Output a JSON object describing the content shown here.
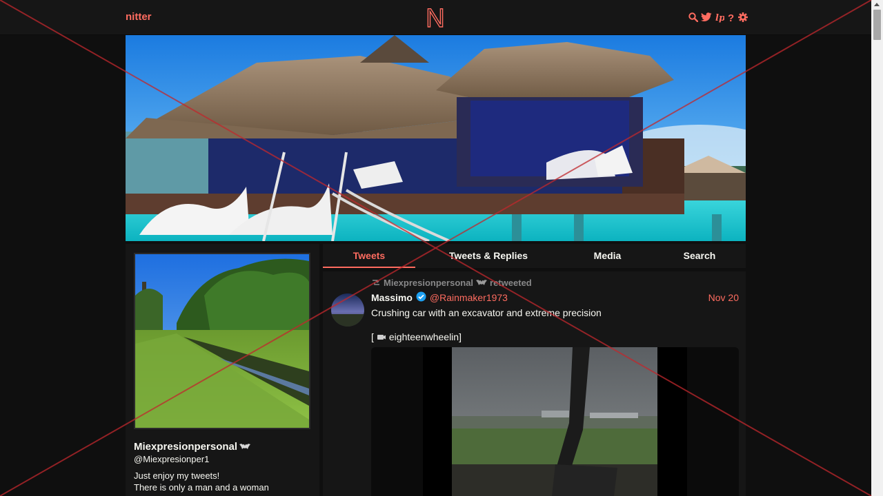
{
  "navbar": {
    "brand": "nitter",
    "logo_letter": "N",
    "icons": [
      "search-icon",
      "twitter-bird-icon",
      "rss-icon",
      "help-icon",
      "gear-icon"
    ]
  },
  "colors": {
    "accent": "#ff6c60",
    "background": "#0f0f0f",
    "panel": "#161616",
    "text": "#f8f8f2",
    "muted": "#888889",
    "verified": "#1da1f2",
    "overlay_x": "#c0282d"
  },
  "profile": {
    "fullname": "Miexpresionpersonal",
    "name_emoji_icon": "bat-icon",
    "username": "@Miexpresionper1",
    "bio": [
      "Just enjoy my tweets!",
      "There is only a man and a woman"
    ]
  },
  "tabs": [
    {
      "label": "Tweets",
      "active": true
    },
    {
      "label": "Tweets & Replies",
      "active": false
    },
    {
      "label": "Media",
      "active": false
    },
    {
      "label": "Search",
      "active": false
    }
  ],
  "tweet": {
    "retweet_by": "Miexpresionpersonal",
    "retweet_suffix": "retweeted",
    "fullname": "Massimo",
    "verified": true,
    "username": "@Rainmaker1973",
    "date": "Nov 20",
    "text": "Crushing car with an excavator and extreme precision",
    "credit_open": "[",
    "credit_icon": "camera-icon",
    "credit_name": "eighteenwheelin]"
  }
}
